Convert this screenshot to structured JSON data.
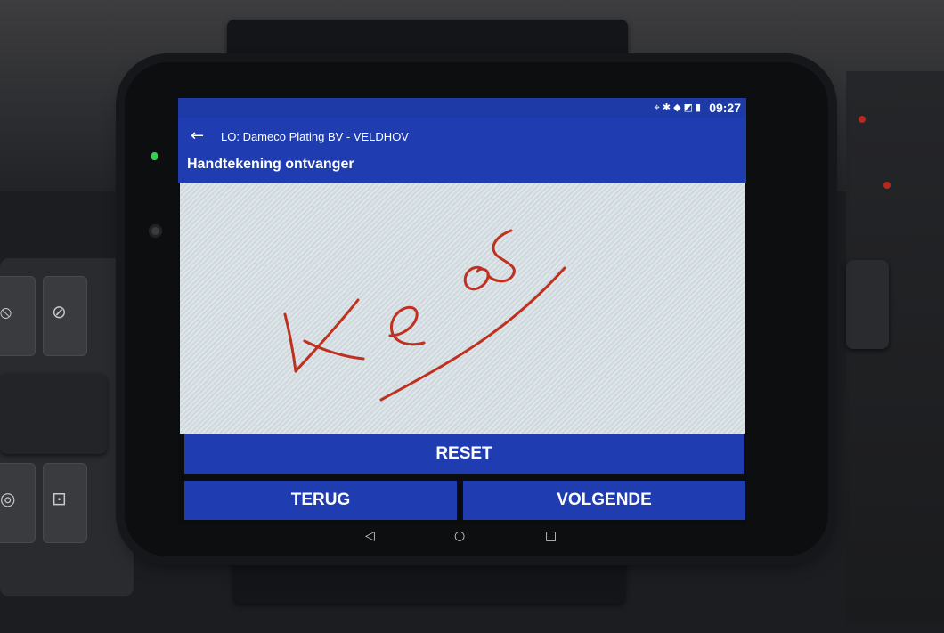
{
  "status_bar": {
    "time": "09:27",
    "icons": [
      "location-icon",
      "bluetooth-icon",
      "wifi-icon",
      "signal-icon",
      "battery-icon"
    ]
  },
  "app_bar": {
    "subtitle": "LO: Dameco Plating BV - VELDHOV",
    "title": "Handtekening ontvanger",
    "back_icon": "arrow-left-icon"
  },
  "signature_pad": {
    "has_signature": true
  },
  "buttons": {
    "reset": "RESET",
    "back": "TERUG",
    "next": "VOLGENDE"
  },
  "nav_bar": {
    "back_icon": "nav-back-icon",
    "home_icon": "nav-home-icon",
    "recent_icon": "nav-recent-apps-icon"
  },
  "colors": {
    "primary": "#1f3db0",
    "status_bar": "#1d3aa6",
    "ink": "#c0301e",
    "pad_background": "#dfe6ea"
  }
}
